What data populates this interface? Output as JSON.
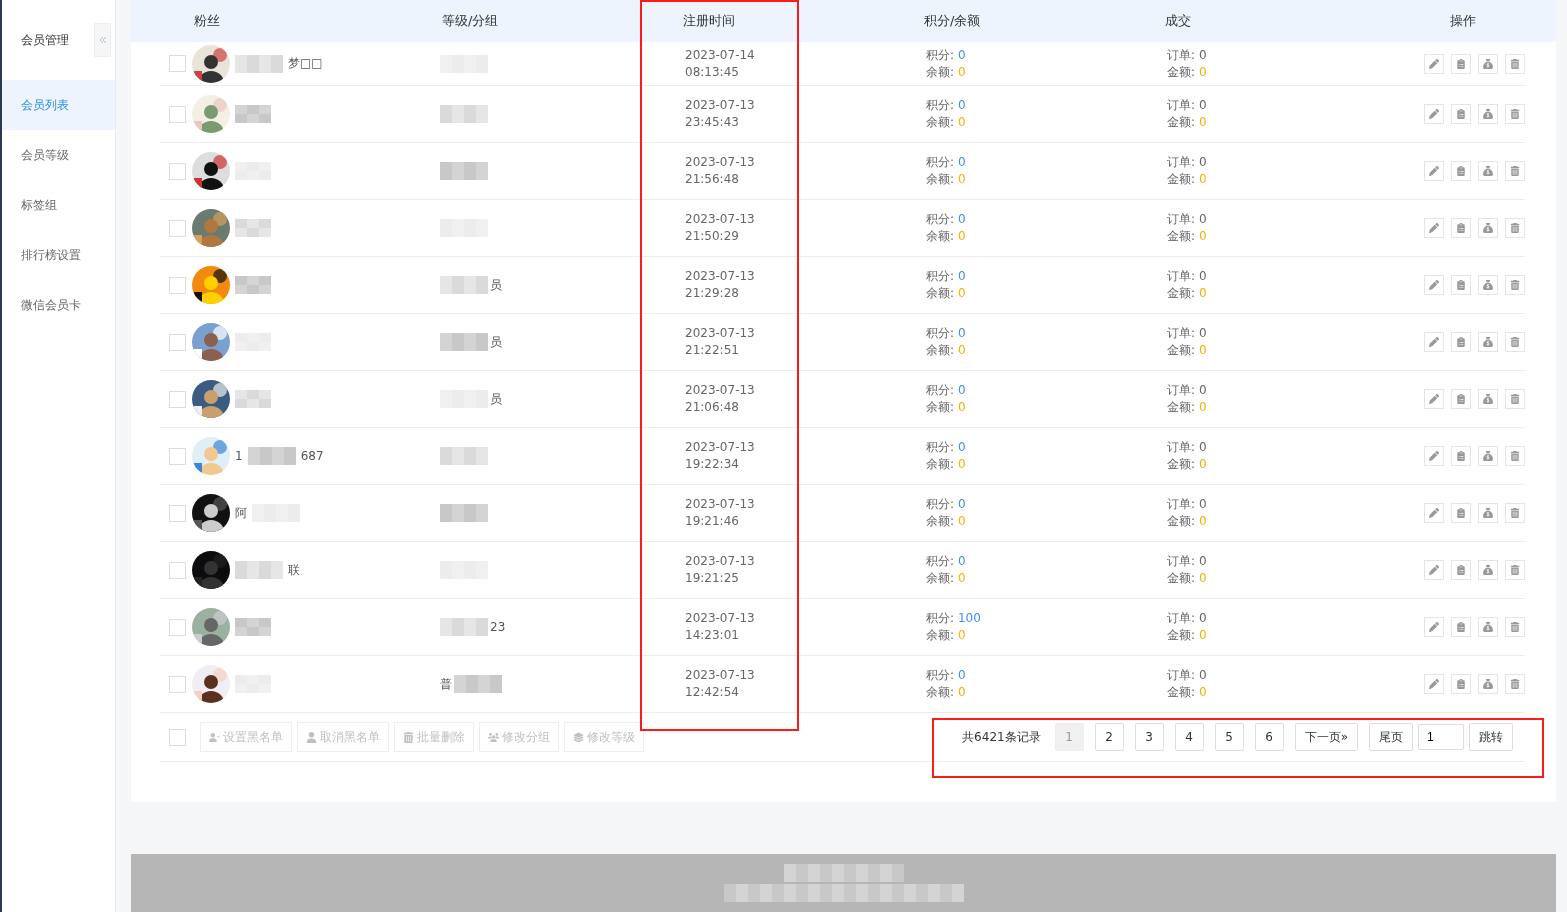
{
  "sidebar": {
    "title": "会员管理",
    "items": [
      {
        "label": "会员列表",
        "selected": true
      },
      {
        "label": "会员等级",
        "selected": false
      },
      {
        "label": "标签组",
        "selected": false
      },
      {
        "label": "排行榜设置",
        "selected": false
      },
      {
        "label": "微信会员卡",
        "selected": false
      }
    ]
  },
  "table": {
    "columns": [
      "粉丝",
      "等级/分组",
      "注册时间",
      "积分/余额",
      "成交",
      "操作"
    ],
    "rows": [
      {
        "checked": false,
        "name_before": "",
        "name_after": "梦□□",
        "group_before": "",
        "group_after": "",
        "time": [
          "2023-07-14",
          "08:13:45"
        ],
        "points_label": "积分:",
        "points": "0",
        "balance_label": "余额:",
        "balance": "0",
        "orders_label": "订单:",
        "orders": "0",
        "amount_label": "金额:",
        "amount": "0"
      },
      {
        "checked": false,
        "name_before": "",
        "name_after": "",
        "group_before": "",
        "group_after": "",
        "time": [
          "2023-07-13",
          "23:45:43"
        ],
        "points_label": "积分:",
        "points": "0",
        "balance_label": "余额:",
        "balance": "0",
        "orders_label": "订单:",
        "orders": "0",
        "amount_label": "金额:",
        "amount": "0"
      },
      {
        "checked": false,
        "name_before": "",
        "name_after": "",
        "group_before": "",
        "group_after": "",
        "time": [
          "2023-07-13",
          "21:56:48"
        ],
        "points_label": "积分:",
        "points": "0",
        "balance_label": "余额:",
        "balance": "0",
        "orders_label": "订单:",
        "orders": "0",
        "amount_label": "金额:",
        "amount": "0"
      },
      {
        "checked": false,
        "name_before": "",
        "name_after": "",
        "group_before": "",
        "group_after": "",
        "time": [
          "2023-07-13",
          "21:50:29"
        ],
        "points_label": "积分:",
        "points": "0",
        "balance_label": "余额:",
        "balance": "0",
        "orders_label": "订单:",
        "orders": "0",
        "amount_label": "金额:",
        "amount": "0"
      },
      {
        "checked": false,
        "name_before": "",
        "name_after": "",
        "group_before": "",
        "group_after": "员",
        "time": [
          "2023-07-13",
          "21:29:28"
        ],
        "points_label": "积分:",
        "points": "0",
        "balance_label": "余额:",
        "balance": "0",
        "orders_label": "订单:",
        "orders": "0",
        "amount_label": "金额:",
        "amount": "0"
      },
      {
        "checked": false,
        "name_before": "",
        "name_after": "",
        "group_before": "",
        "group_after": "员",
        "time": [
          "2023-07-13",
          "21:22:51"
        ],
        "points_label": "积分:",
        "points": "0",
        "balance_label": "余额:",
        "balance": "0",
        "orders_label": "订单:",
        "orders": "0",
        "amount_label": "金额:",
        "amount": "0"
      },
      {
        "checked": false,
        "name_before": "",
        "name_after": "",
        "group_before": "",
        "group_after": "员",
        "time": [
          "2023-07-13",
          "21:06:48"
        ],
        "points_label": "积分:",
        "points": "0",
        "balance_label": "余额:",
        "balance": "0",
        "orders_label": "订单:",
        "orders": "0",
        "amount_label": "金额:",
        "amount": "0"
      },
      {
        "checked": false,
        "name_before": "1",
        "name_after": "687",
        "group_before": "",
        "group_after": "",
        "time": [
          "2023-07-13",
          "19:22:34"
        ],
        "points_label": "积分:",
        "points": "0",
        "balance_label": "余额:",
        "balance": "0",
        "orders_label": "订单:",
        "orders": "0",
        "amount_label": "金额:",
        "amount": "0"
      },
      {
        "checked": false,
        "name_before": "阿",
        "name_after": "",
        "group_before": "",
        "group_after": "",
        "time": [
          "2023-07-13",
          "19:21:46"
        ],
        "points_label": "积分:",
        "points": "0",
        "balance_label": "余额:",
        "balance": "0",
        "orders_label": "订单:",
        "orders": "0",
        "amount_label": "金额:",
        "amount": "0"
      },
      {
        "checked": false,
        "name_before": "",
        "name_after": "联",
        "group_before": "",
        "group_after": "",
        "time": [
          "2023-07-13",
          "19:21:25"
        ],
        "points_label": "积分:",
        "points": "0",
        "balance_label": "余额:",
        "balance": "0",
        "orders_label": "订单:",
        "orders": "0",
        "amount_label": "金额:",
        "amount": "0"
      },
      {
        "checked": false,
        "name_before": "",
        "name_after": "",
        "group_before": "",
        "group_after": "23",
        "time": [
          "2023-07-13",
          "14:23:01"
        ],
        "points_label": "积分:",
        "points": "100",
        "balance_label": "余额:",
        "balance": "0",
        "orders_label": "订单:",
        "orders": "0",
        "amount_label": "金额:",
        "amount": "0"
      },
      {
        "checked": false,
        "name_before": "",
        "name_after": "",
        "group_before": "普",
        "group_after": "",
        "time": [
          "2023-07-13",
          "12:42:54"
        ],
        "points_label": "积分:",
        "points": "0",
        "balance_label": "余额:",
        "balance": "0",
        "orders_label": "订单:",
        "orders": "0",
        "amount_label": "金额:",
        "amount": "0"
      }
    ]
  },
  "bulk": {
    "checked": false,
    "buttons": [
      {
        "kind": "blacklist",
        "label": "设置黑名单",
        "disabled": true
      },
      {
        "kind": "unblacklist",
        "label": "取消黑名单",
        "disabled": true
      },
      {
        "kind": "delete",
        "label": "批量删除",
        "disabled": true
      },
      {
        "kind": "group",
        "label": "修改分组",
        "disabled": true
      },
      {
        "kind": "level",
        "label": "修改等级",
        "disabled": true
      }
    ]
  },
  "pagination": {
    "total": "共6421条记录",
    "pages": [
      {
        "label": "1",
        "selected": true
      },
      {
        "label": "2",
        "selected": false
      },
      {
        "label": "3",
        "selected": false
      },
      {
        "label": "4",
        "selected": false
      },
      {
        "label": "5",
        "selected": false
      },
      {
        "label": "6",
        "selected": false
      }
    ],
    "next": "下一页»",
    "last": "尾页",
    "jump_value": "1",
    "jump": "跳转"
  }
}
